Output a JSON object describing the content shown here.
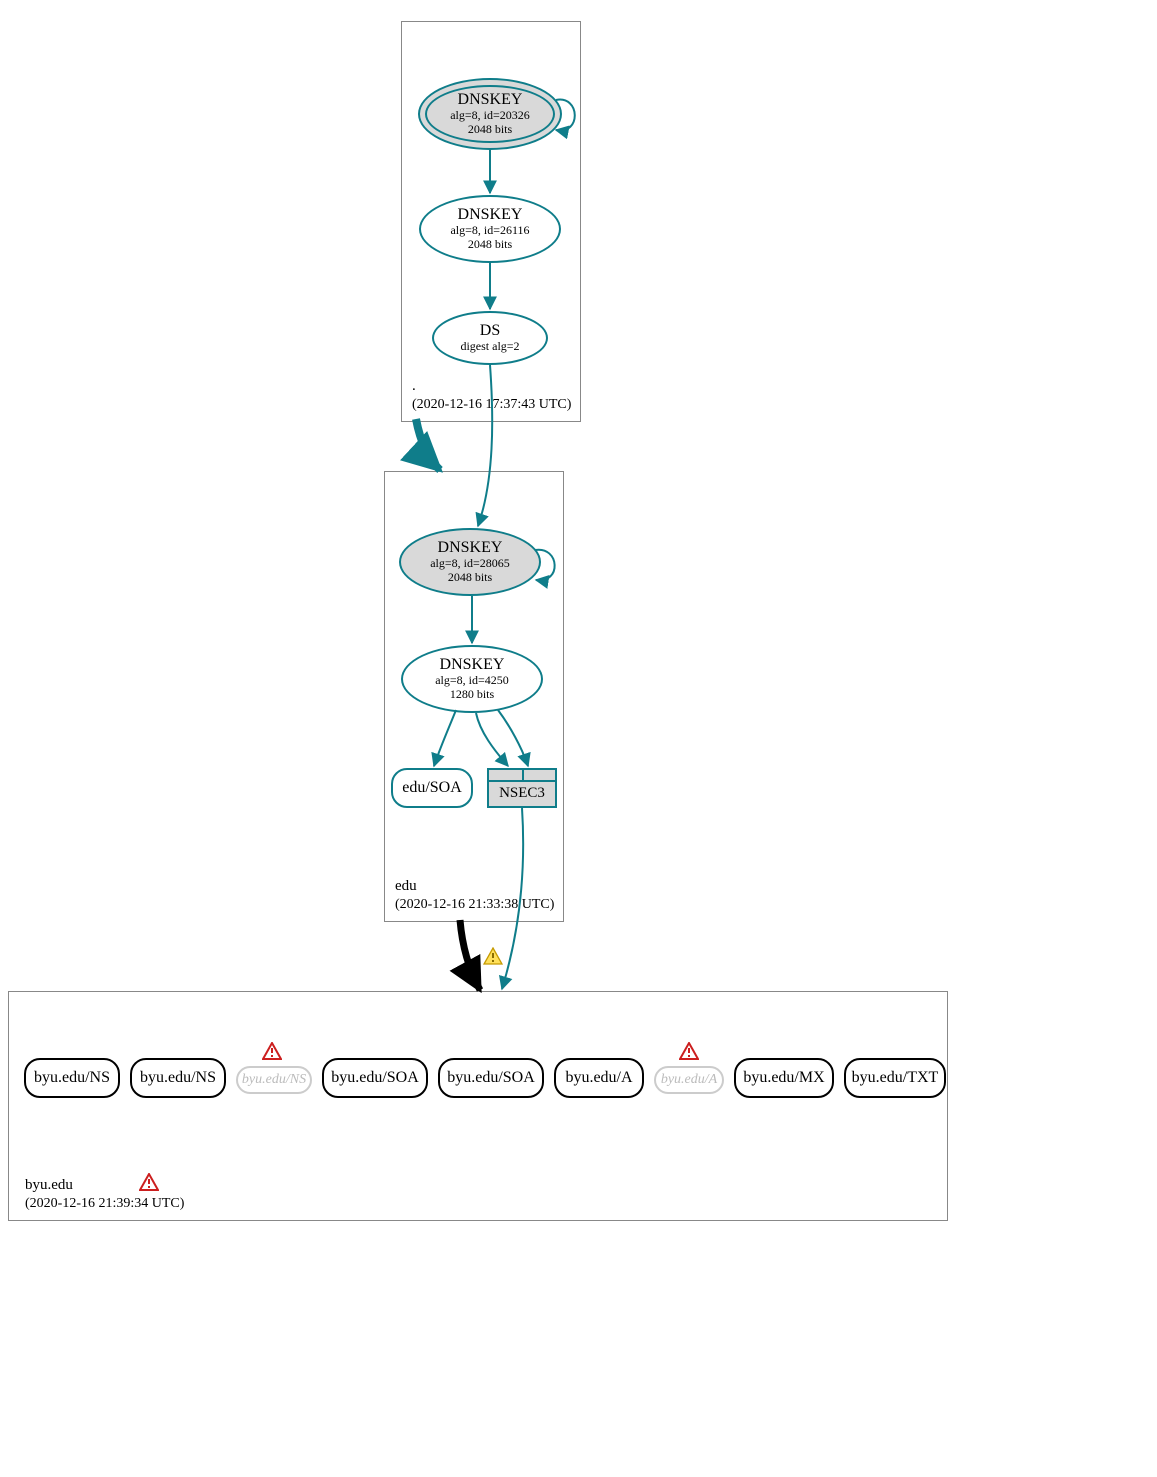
{
  "zones": {
    "root": {
      "name": ".",
      "timestamp": "(2020-12-16 17:37:43 UTC)"
    },
    "edu": {
      "name": "edu",
      "timestamp": "(2020-12-16 21:33:38 UTC)"
    },
    "byu": {
      "name": "byu.edu",
      "timestamp": "(2020-12-16 21:39:34 UTC)"
    }
  },
  "nodes": {
    "root_ksk": {
      "title": "DNSKEY",
      "sub1": "alg=8, id=20326",
      "sub2": "2048 bits"
    },
    "root_zsk": {
      "title": "DNSKEY",
      "sub1": "alg=8, id=26116",
      "sub2": "2048 bits"
    },
    "root_ds": {
      "title": "DS",
      "sub1": "digest alg=2"
    },
    "edu_ksk": {
      "title": "DNSKEY",
      "sub1": "alg=8, id=28065",
      "sub2": "2048 bits"
    },
    "edu_zsk": {
      "title": "DNSKEY",
      "sub1": "alg=8, id=4250",
      "sub2": "1280 bits"
    },
    "edu_soa": {
      "label": "edu/SOA"
    },
    "edu_nsec3": {
      "label": "NSEC3"
    }
  },
  "byu_records": [
    {
      "label": "byu.edu/NS",
      "faded": false,
      "warn": false
    },
    {
      "label": "byu.edu/NS",
      "faded": false,
      "warn": false
    },
    {
      "label": "byu.edu/NS",
      "faded": true,
      "warn": true
    },
    {
      "label": "byu.edu/SOA",
      "faded": false,
      "warn": false
    },
    {
      "label": "byu.edu/SOA",
      "faded": false,
      "warn": false
    },
    {
      "label": "byu.edu/A",
      "faded": false,
      "warn": false
    },
    {
      "label": "byu.edu/A",
      "faded": true,
      "warn": true
    },
    {
      "label": "byu.edu/MX",
      "faded": false,
      "warn": false
    },
    {
      "label": "byu.edu/TXT",
      "faded": false,
      "warn": false
    }
  ],
  "zone_warning": true
}
